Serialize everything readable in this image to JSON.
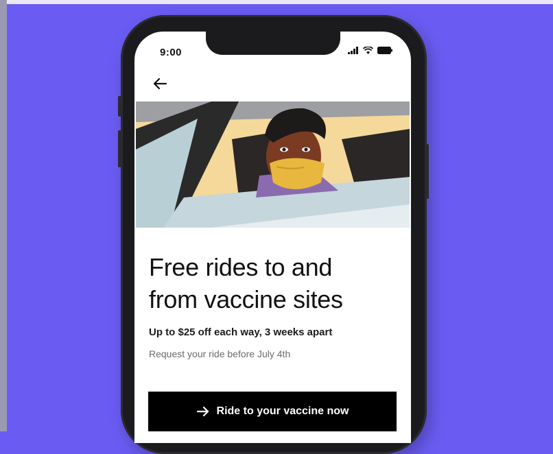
{
  "status_bar": {
    "time": "9:00"
  },
  "content": {
    "title": "Free rides to and from vaccine sites",
    "subtitle": "Up to $25 off each way, 3 weeks apart",
    "note": "Request your ride before July 4th",
    "cta_label": "Ride to your vaccine now"
  },
  "colors": {
    "background": "#6a5cf2",
    "cta": "#000000",
    "mask": "#e7b83d"
  },
  "icons": [
    "back-arrow-icon",
    "signal-icon",
    "wifi-icon",
    "battery-icon",
    "arrow-right-icon"
  ]
}
